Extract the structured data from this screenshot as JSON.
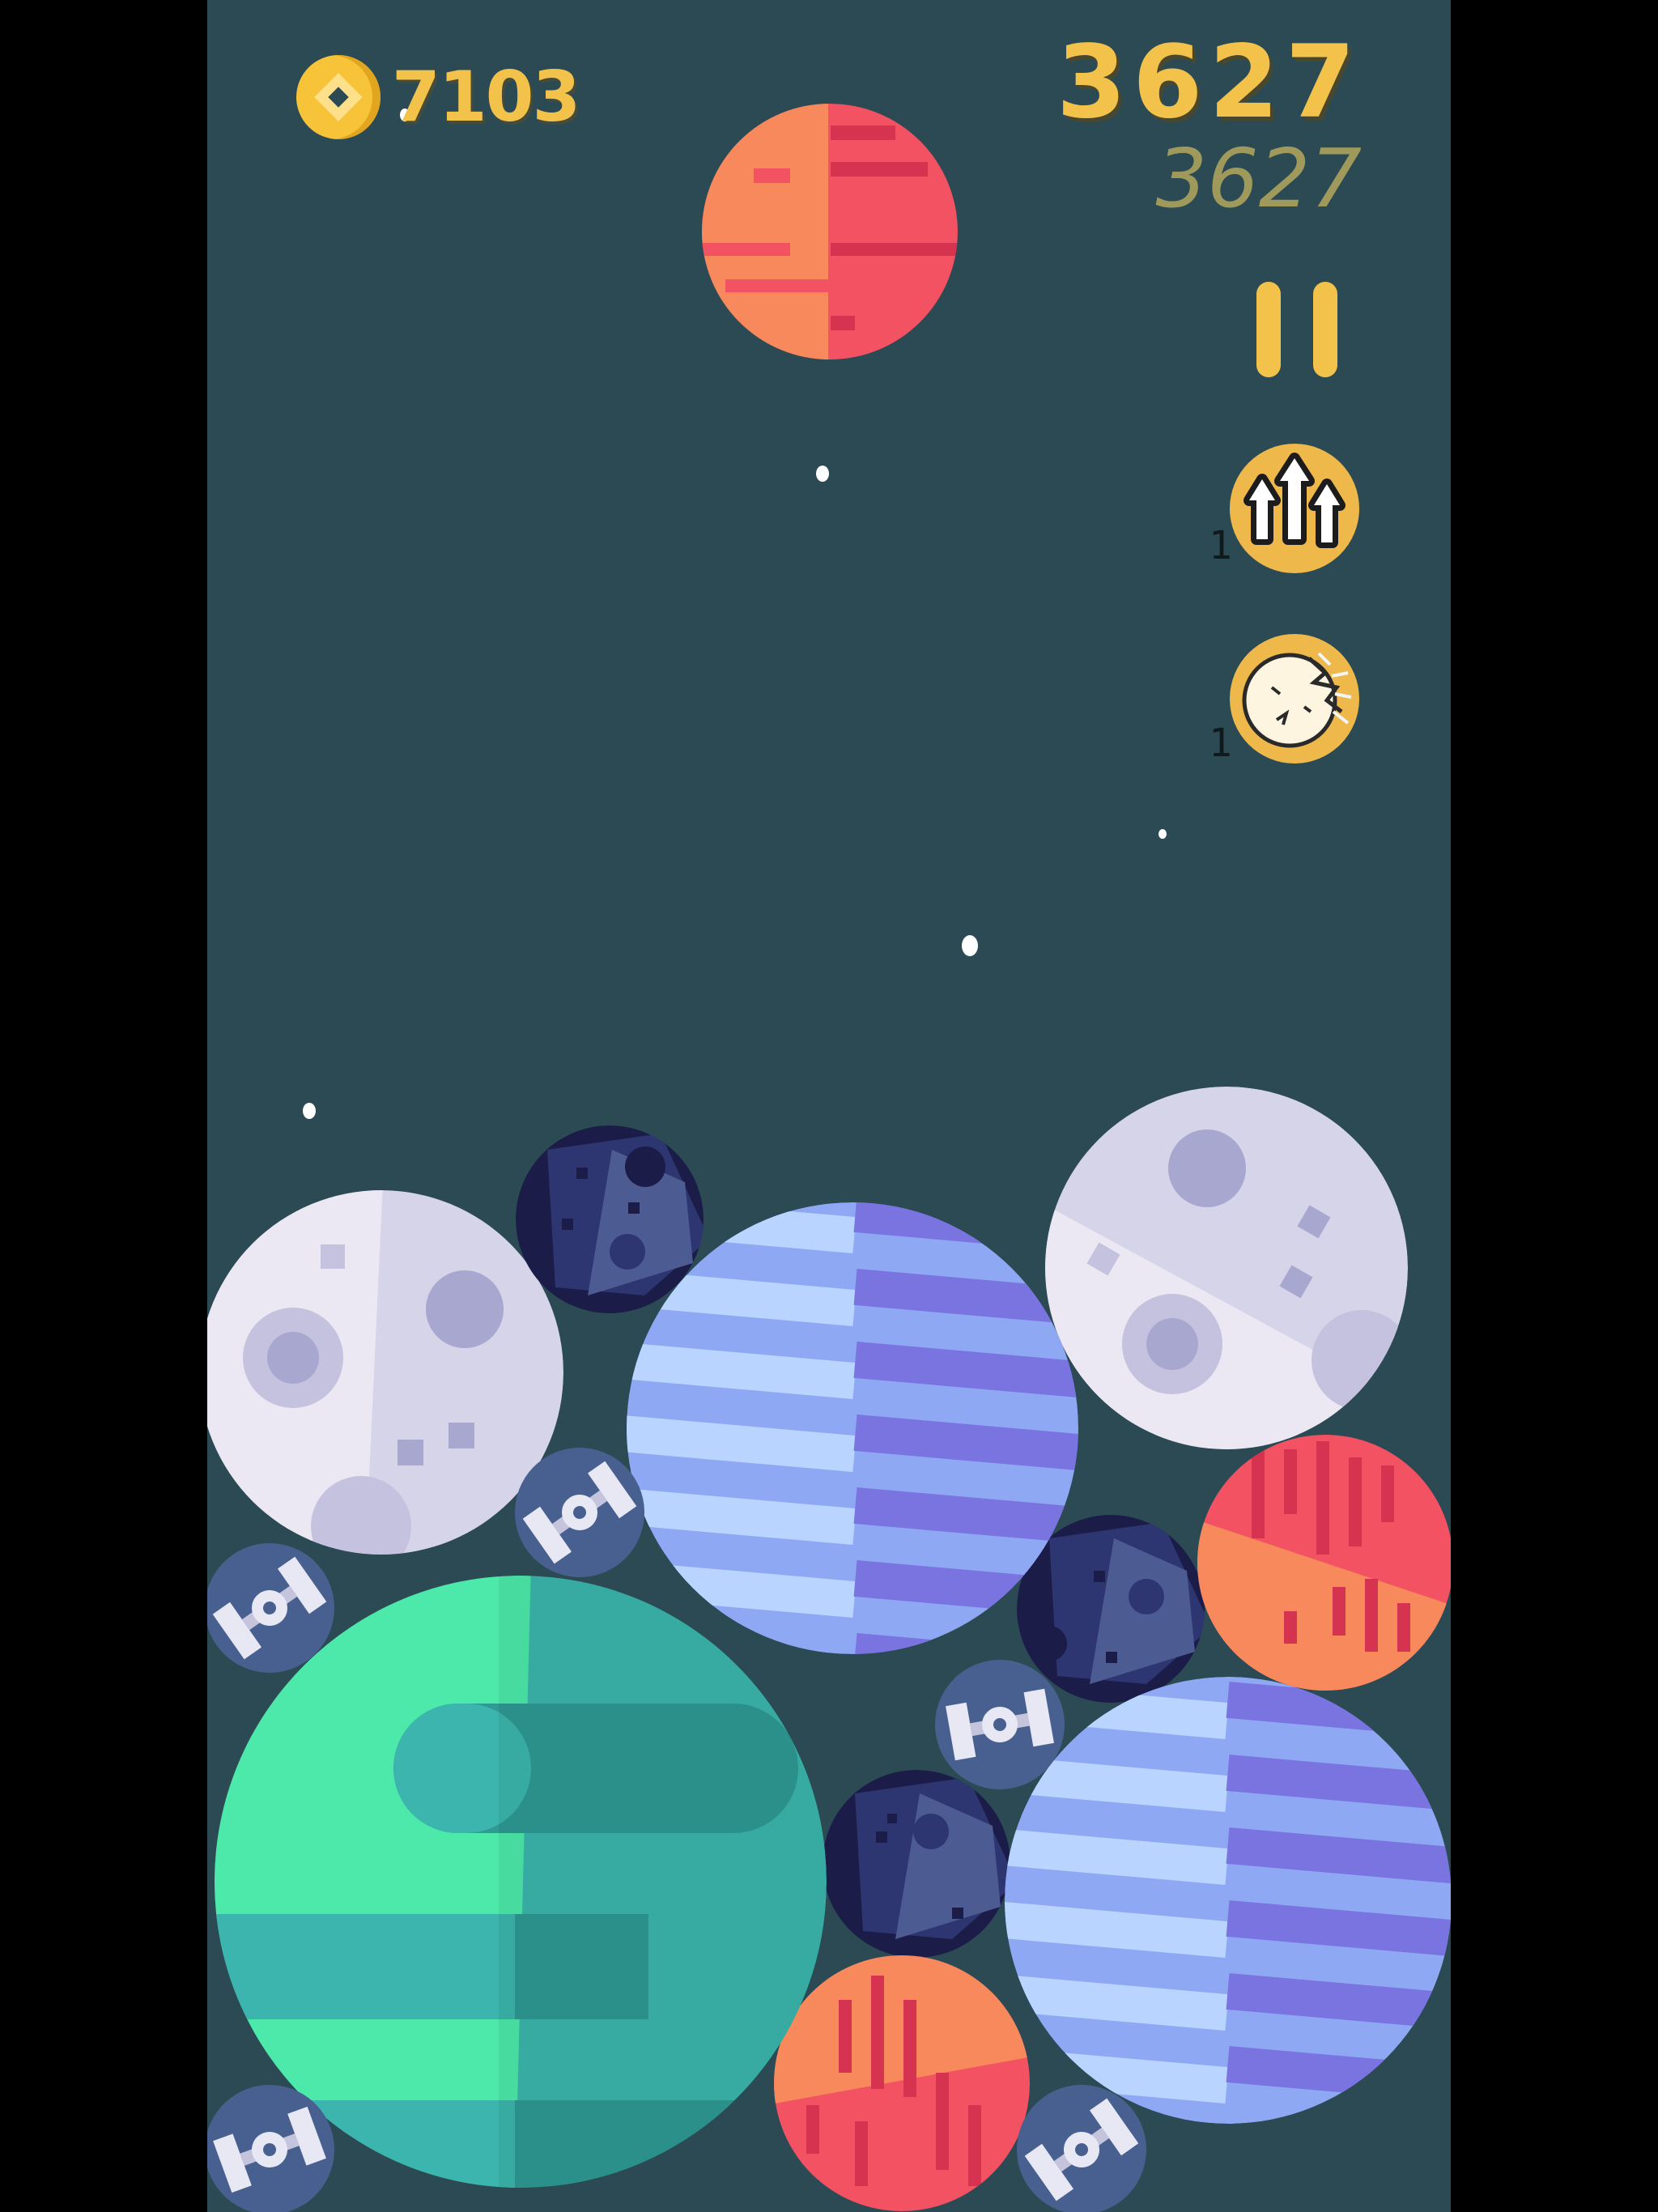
{
  "hud": {
    "coins": "7103",
    "score": "3627",
    "best_score": "3627"
  },
  "powerups": [
    {
      "name": "upgrade",
      "icon": "triple-arrow-up-icon",
      "count": "1"
    },
    {
      "name": "smash",
      "icon": "cracked-planet-icon",
      "count": "1"
    }
  ],
  "planet_types": [
    "red-planet",
    "moon",
    "asteroid",
    "blue-gas-giant",
    "green-planet",
    "satellite"
  ],
  "colors": {
    "background": "#2b4a54",
    "accent": "#f3c24b"
  }
}
